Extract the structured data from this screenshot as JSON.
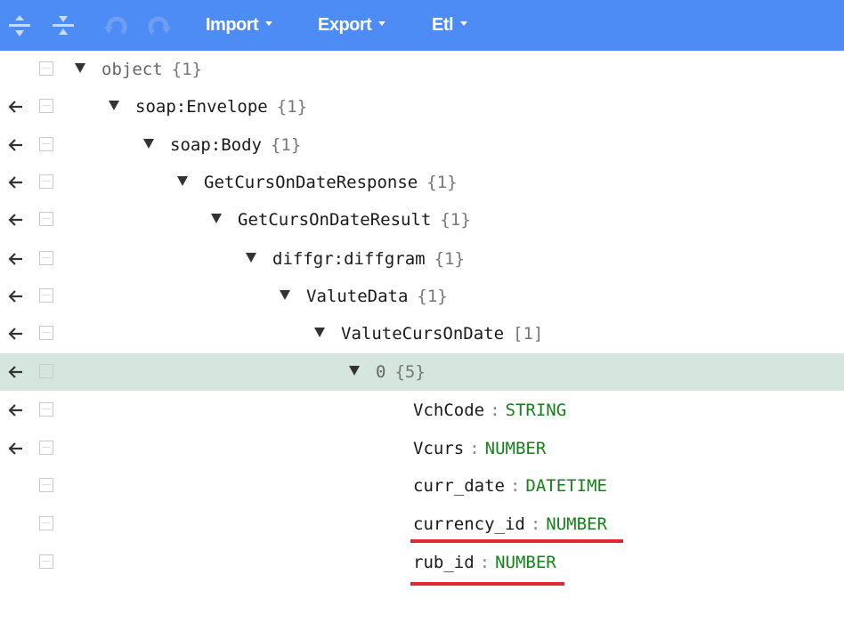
{
  "toolbar": {
    "icons": [
      "expand-all-icon",
      "collapse-all-icon",
      "undo-icon",
      "redo-icon"
    ],
    "menus": [
      {
        "label": "Import"
      },
      {
        "label": "Export"
      },
      {
        "label": "Etl"
      }
    ],
    "background_color": "#4d8cf5"
  },
  "tree": {
    "rows": [
      {
        "key": "object",
        "count": "{1}",
        "has_arrow": false
      },
      {
        "key": "soap:Envelope",
        "count": "{1}",
        "has_arrow": true
      },
      {
        "key": "soap:Body",
        "count": "{1}",
        "has_arrow": true
      },
      {
        "key": "GetCursOnDateResponse",
        "count": "{1}",
        "has_arrow": true
      },
      {
        "key": "GetCursOnDateResult",
        "count": "{1}",
        "has_arrow": true
      },
      {
        "key": "diffgr:diffgram",
        "count": "{1}",
        "has_arrow": true
      },
      {
        "key": "ValuteData",
        "count": "{1}",
        "has_arrow": true
      },
      {
        "key": "ValuteCursOnDate",
        "count": "[1]",
        "has_arrow": true
      },
      {
        "key": "0",
        "count": "{5}",
        "has_arrow": true,
        "selected": true
      },
      {
        "key": "VchCode",
        "separator": ":",
        "value": "STRING",
        "has_arrow": true
      },
      {
        "key": "Vcurs",
        "separator": ":",
        "value": "NUMBER",
        "has_arrow": true
      },
      {
        "key": "curr_date",
        "separator": ":",
        "value": "DATETIME",
        "has_arrow": false
      },
      {
        "key": "currency_id",
        "separator": ":",
        "value": "NUMBER",
        "has_arrow": false,
        "highlighted": true
      },
      {
        "key": "rub_id",
        "separator": ":",
        "value": "NUMBER",
        "has_arrow": false,
        "highlighted": true
      }
    ],
    "selected_row_color": "#d4e6dd",
    "value_color": "#16801b",
    "highlight_underline_color": "#e0282e"
  }
}
